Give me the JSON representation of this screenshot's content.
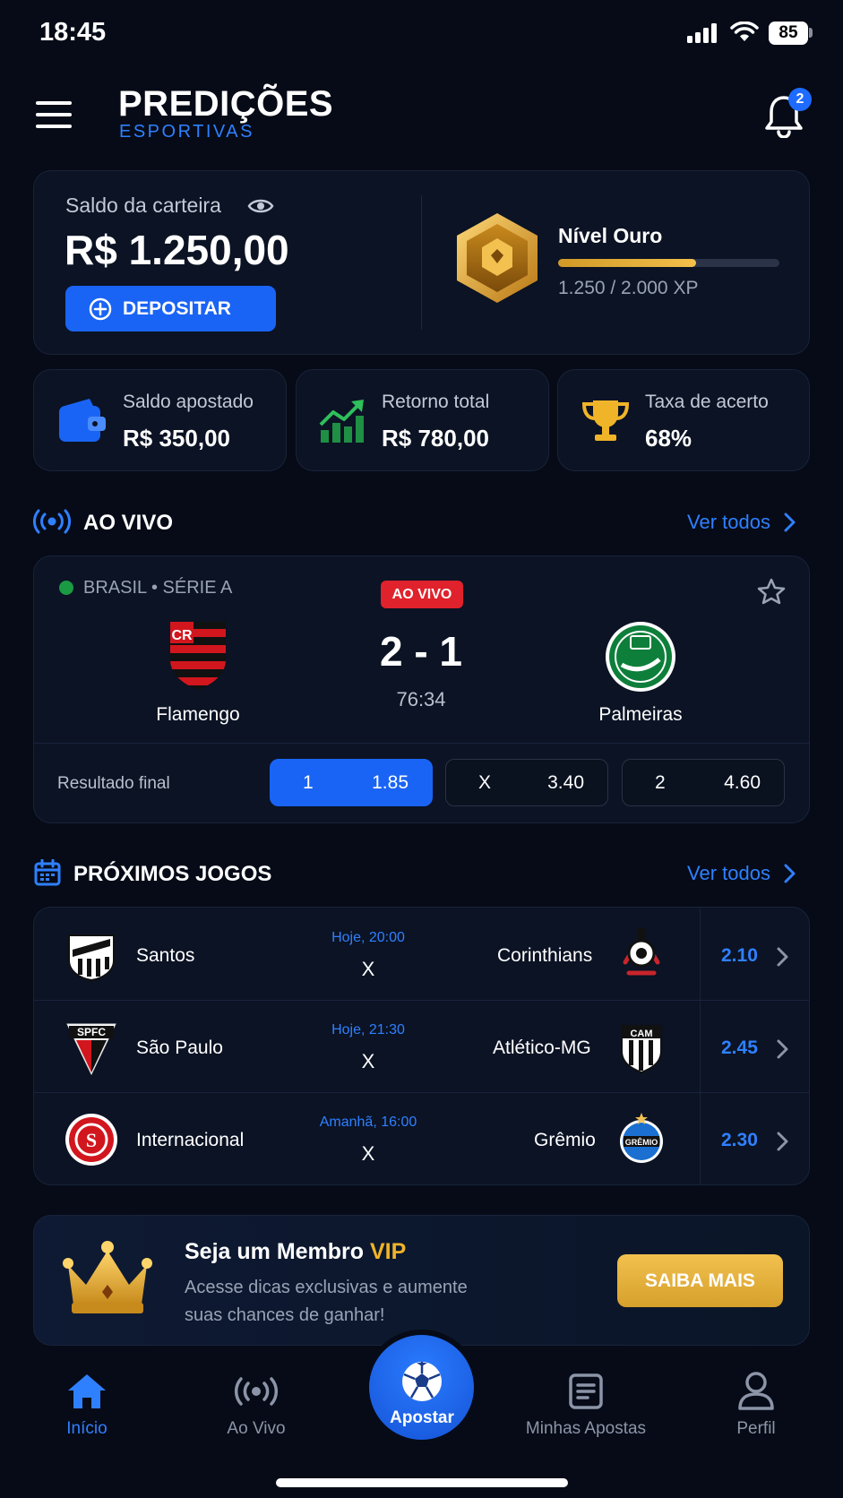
{
  "status_bar": {
    "time": "18:45",
    "battery": "85"
  },
  "header": {
    "title": "PREDIÇÕES",
    "subtitle": "ESPORTIVAS",
    "notifications_count": "2"
  },
  "wallet": {
    "label": "Saldo da carteira",
    "balance": "R$ 1.250,00",
    "deposit_label": "DEPOSITAR",
    "level": "Nível Ouro",
    "xp_text": "1.250 / 2.000 XP",
    "xp_progress": 0.625
  },
  "stats": [
    {
      "label": "Saldo apostado",
      "value": "R$ 350,00",
      "icon": "wallet-icon"
    },
    {
      "label": "Retorno total",
      "value": "R$ 780,00",
      "icon": "chart-up-icon"
    },
    {
      "label": "Taxa de acerto",
      "value": "68%",
      "icon": "trophy-icon"
    }
  ],
  "live": {
    "section_title": "AO VIVO",
    "see_all": "Ver todos",
    "league": "BRASIL • SÉRIE A",
    "badge": "AO VIVO",
    "home_team": "Flamengo",
    "away_team": "Palmeiras",
    "score": "2 - 1",
    "clock": "76:34",
    "market_label": "Resultado final",
    "odds": [
      {
        "pick": "1",
        "value": "1.85",
        "selected": true
      },
      {
        "pick": "X",
        "value": "3.40",
        "selected": false
      },
      {
        "pick": "2",
        "value": "4.60",
        "selected": false
      }
    ]
  },
  "upcoming": {
    "section_title": "PRÓXIMOS JOGOS",
    "see_all": "Ver todos",
    "games": [
      {
        "home": "Santos",
        "away": "Corinthians",
        "time": "Hoje, 20:00",
        "separator": "X",
        "odd": "2.10"
      },
      {
        "home": "São Paulo",
        "away": "Atlético-MG",
        "time": "Hoje, 21:30",
        "separator": "X",
        "odd": "2.45"
      },
      {
        "home": "Internacional",
        "away": "Grêmio",
        "time": "Amanhã, 16:00",
        "separator": "X",
        "odd": "2.30"
      }
    ]
  },
  "vip": {
    "title_prefix": "Seja um Membro ",
    "title_highlight": "VIP",
    "description": "Acesse dicas exclusivas e aumente suas chances de ganhar!",
    "button": "SAIBA MAIS"
  },
  "bottom_nav": {
    "home": "Início",
    "live": "Ao Vivo",
    "bet": "Apostar",
    "my_bets": "Minhas Apostas",
    "profile": "Perfil"
  },
  "colors": {
    "accent": "#1a64f5",
    "gold": "#e2ab35",
    "live_red": "#e0222c",
    "background": "#060b17"
  }
}
